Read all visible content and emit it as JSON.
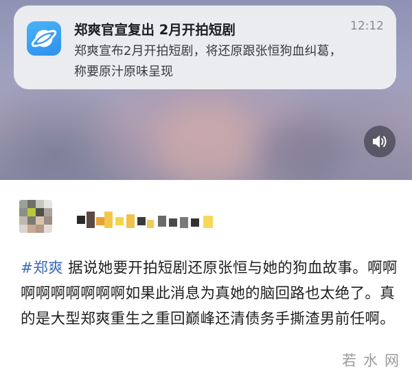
{
  "notification": {
    "title": "郑爽官宣复出 2月开拍短剧",
    "time": "12:12",
    "body": "郑爽宣布2月开拍短剧，将还原跟张恒狗血纠葛，称要原汁原味呈现",
    "app_icon": "planet-icon"
  },
  "video": {
    "sound_icon": "speaker-icon"
  },
  "post": {
    "hashtag": "#郑爽",
    "text": "据说她要开拍短剧还原张恒与她的狗血故事。啊啊啊啊啊啊啊啊啊如果此消息为真她的脑回路也太绝了。真的是大型郑爽重生之重回巅峰还清债务手撕渣男前任啊。"
  },
  "watermark": {
    "text": "若水网"
  },
  "colors": {
    "hashtag": "#3b6bb3",
    "app_icon": "#2f8ff0"
  }
}
